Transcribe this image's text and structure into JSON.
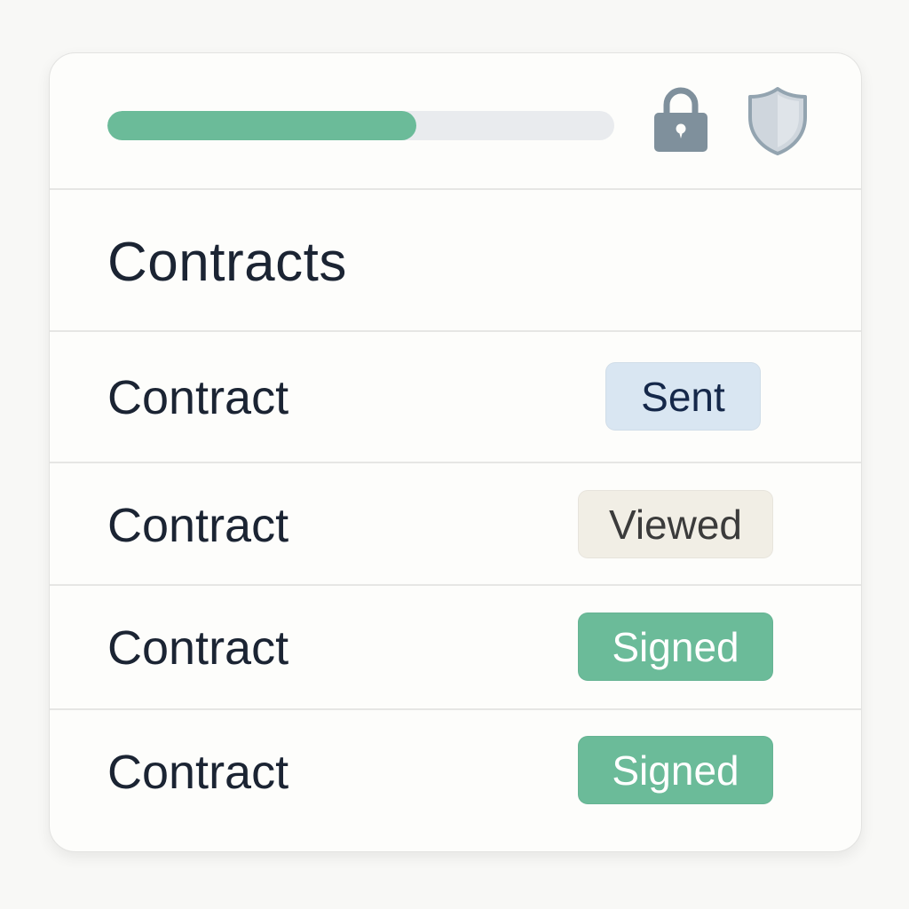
{
  "progress": {
    "fraction": 0.61,
    "fill_color": "#6bbb99",
    "track_color": "#e9ebee"
  },
  "header_icons": [
    "lock-icon",
    "shield-icon"
  ],
  "title": "Contracts",
  "contracts": [
    {
      "label": "Contract",
      "status": "Sent",
      "badge_bg": "#d9e6f2",
      "badge_fg": "#15284a"
    },
    {
      "label": "Contract",
      "status": "Viewed",
      "badge_bg": "#f1eee5",
      "badge_fg": "#3b3b3b"
    },
    {
      "label": "Contract",
      "status": "Signed",
      "badge_bg": "#6bbb99",
      "badge_fg": "#ffffff"
    },
    {
      "label": "Contract",
      "status": "Signed",
      "badge_bg": "#6bbb99",
      "badge_fg": "#ffffff"
    }
  ]
}
